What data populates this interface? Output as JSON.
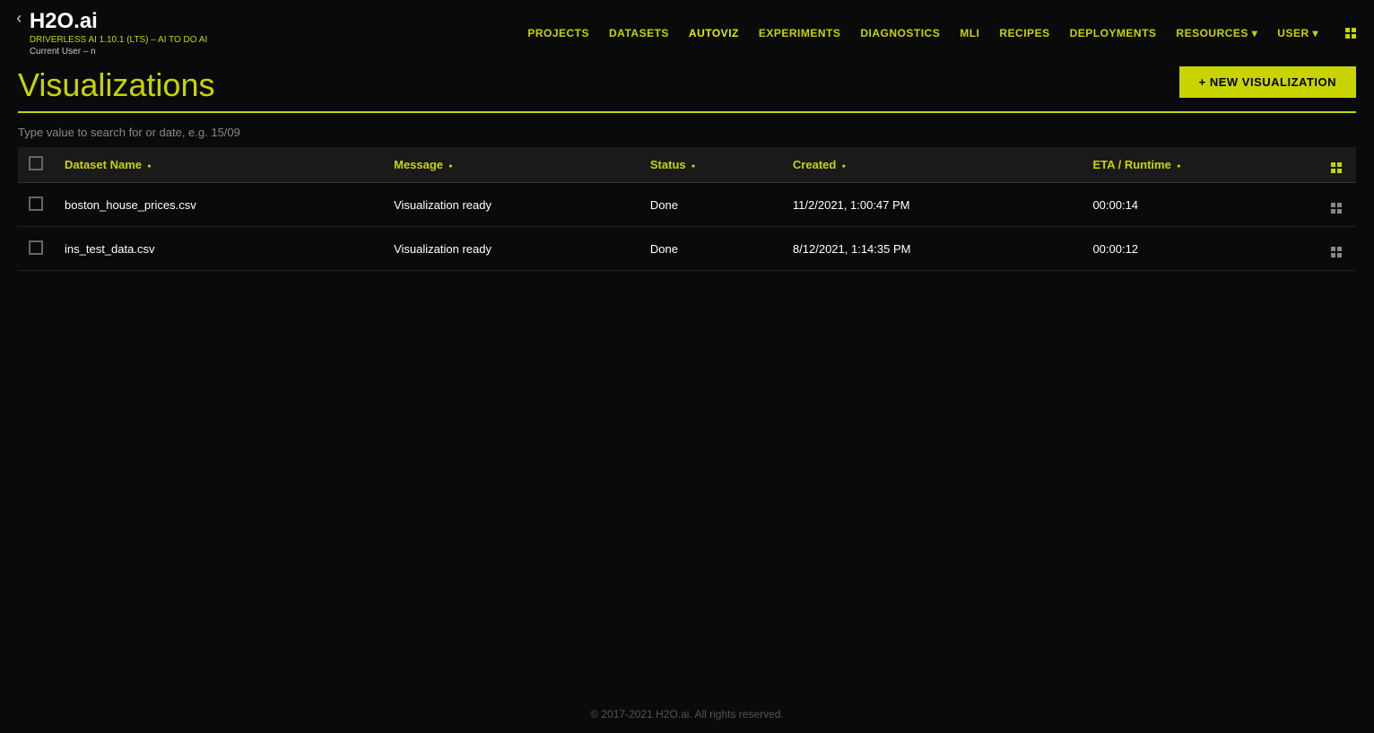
{
  "logo": {
    "text": "H2O.ai",
    "subtitle": "DRIVERLESS AI 1.10.1 (LTS) – AI TO DO AI",
    "current_user_label": "Current User – n"
  },
  "nav": {
    "links": [
      {
        "label": "PROJECTS",
        "id": "projects"
      },
      {
        "label": "DATASETS",
        "id": "datasets"
      },
      {
        "label": "AUTOVIZ",
        "id": "autoviz",
        "active": true
      },
      {
        "label": "EXPERIMENTS",
        "id": "experiments"
      },
      {
        "label": "DIAGNOSTICS",
        "id": "diagnostics"
      },
      {
        "label": "MLI",
        "id": "mli"
      },
      {
        "label": "RECIPES",
        "id": "recipes"
      },
      {
        "label": "DEPLOYMENTS",
        "id": "deployments"
      },
      {
        "label": "RESOURCES ▾",
        "id": "resources"
      },
      {
        "label": "USER ▾",
        "id": "user"
      }
    ]
  },
  "page": {
    "title": "Visualizations",
    "new_button_label": "+ NEW VISUALIZATION"
  },
  "search": {
    "placeholder": "Type value to search for or date, e.g. 15/09"
  },
  "table": {
    "columns": [
      {
        "label": "Dataset Name ⬩",
        "id": "dataset_name"
      },
      {
        "label": "Message ⬩",
        "id": "message"
      },
      {
        "label": "Status ⬩",
        "id": "status"
      },
      {
        "label": "Created ⬩",
        "id": "created"
      },
      {
        "label": "ETA / Runtime ⬩",
        "id": "eta_runtime"
      }
    ],
    "rows": [
      {
        "dataset_name": "boston_house_prices.csv",
        "message": "Visualization ready",
        "status": "Done",
        "created": "11/2/2021, 1:00:47 PM",
        "eta_runtime": "00:00:14"
      },
      {
        "dataset_name": "ins_test_data.csv",
        "message": "Visualization ready",
        "status": "Done",
        "created": "8/12/2021, 1:14:35 PM",
        "eta_runtime": "00:00:12"
      }
    ]
  },
  "footer": {
    "text": "© 2017-2021 H2O.ai. All rights reserved."
  }
}
